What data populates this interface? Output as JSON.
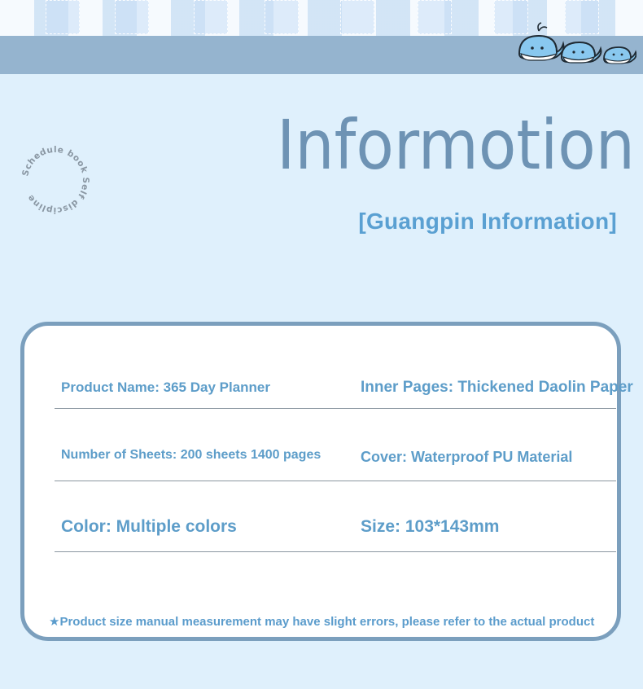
{
  "header": {
    "title": "Informotion",
    "subtitle": "[Guangpin Information]",
    "seal_text": "Schedule book Self discipline"
  },
  "info": {
    "rows": [
      {
        "left": "Product Name: 365 Day Planner",
        "right": "Inner Pages: Thickened Daolin Paper"
      },
      {
        "left": "Number of Sheets: 200 sheets 1400 pages",
        "right": "Cover: Waterproof PU Material"
      },
      {
        "left": "Color: Multiple colors",
        "right": "Size: 103*143mm"
      }
    ],
    "note": "★Product size manual measurement may have slight errors, please refer to the actual product"
  },
  "colors": {
    "background": "#dff0fc",
    "band": "#95b4cf",
    "title": "#6e93b4",
    "accent_text": "#5d9dc9",
    "card_border": "#7b9fbd"
  },
  "icons": [
    "whale-icon",
    "whale-icon",
    "whale-icon"
  ]
}
